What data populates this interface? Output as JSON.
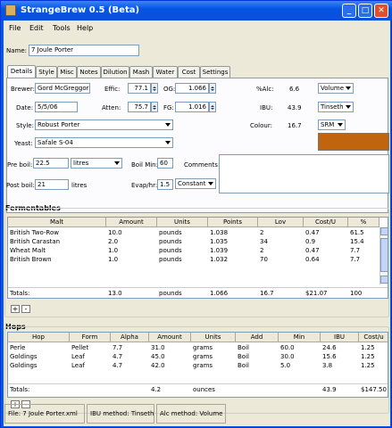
{
  "window": {
    "title": "StrangeBrew 0.5 (Beta)"
  },
  "menu": [
    "File",
    "Edit",
    "Tools",
    "Help"
  ],
  "name": {
    "label": "Name:",
    "value": "7 Joule Porter"
  },
  "tabs": [
    "Details",
    "Style",
    "Misc",
    "Notes",
    "Dilution",
    "Mash",
    "Water",
    "Cost",
    "Settings"
  ],
  "details": {
    "brewer_label": "Brewer:",
    "brewer": "Gord McGreggor",
    "effic_label": "Effic:",
    "effic": "77.1",
    "og_label": "OG:",
    "og": "1.066",
    "alc_label": "%Alc:",
    "alc": "6.6",
    "alc_method": "Volume",
    "date_label": "Date:",
    "date": "5/5/06",
    "atten_label": "Atten:",
    "atten": "75.7",
    "fg_label": "FG:",
    "fg": "1.016",
    "ibu_label": "IBU:",
    "ibu": "43.9",
    "ibu_method": "Tinseth",
    "style_label": "Style:",
    "style": "Robust Porter",
    "colour_label": "Colour:",
    "colour": "16.7",
    "colour_method": "SRM",
    "colour_swatch": "#c0650e",
    "yeast_label": "Yeast:",
    "yeast": "Safale S-04",
    "preboil_label": "Pre boil:",
    "preboil": "22.5",
    "preboil_unit": "litres",
    "boilmin_label": "Boil Min:",
    "boilmin": "60",
    "comments_label": "Comments:",
    "postboil_label": "Post boil:",
    "postboil": "21",
    "postboil_unit": "litres",
    "evap_label": "Evap/hr:",
    "evap": "1.5",
    "evap_method": "Constant"
  },
  "fermentables": {
    "title": "Fermentables",
    "headers": [
      "Malt",
      "Amount",
      "Units",
      "Points",
      "Lov",
      "Cost/U",
      "%"
    ],
    "rows": [
      [
        "British Two-Row",
        "10.0",
        "pounds",
        "1.038",
        "2",
        "0.47",
        "61.5"
      ],
      [
        "British Carastan",
        "2.0",
        "pounds",
        "1.035",
        "34",
        "0.9",
        "15.4"
      ],
      [
        "Wheat Malt",
        "1.0",
        "pounds",
        "1.039",
        "2",
        "0.47",
        "7.7"
      ],
      [
        "British Brown",
        "1.0",
        "pounds",
        "1.032",
        "70",
        "0.64",
        "7.7"
      ]
    ],
    "totals": [
      "Totals:",
      "13.0",
      "pounds",
      "1.066",
      "16.7",
      "$21.07",
      "100"
    ]
  },
  "hops": {
    "title": "Hops",
    "headers": [
      "Hop",
      "Form",
      "Alpha",
      "Amount",
      "Units",
      "Add",
      "Min",
      "IBU",
      "Cost/u"
    ],
    "rows": [
      [
        "Perle",
        "Pellet",
        "7.7",
        "31.0",
        "grams",
        "Boil",
        "60.0",
        "24.6",
        "1.25"
      ],
      [
        "Goldings",
        "Leaf",
        "4.7",
        "45.0",
        "grams",
        "Boil",
        "30.0",
        "15.6",
        "1.25"
      ],
      [
        "Goldings",
        "Leaf",
        "4.7",
        "42.0",
        "grams",
        "Boil",
        "5.0",
        "3.8",
        "1.25"
      ]
    ],
    "totals": [
      "Totals:",
      "4.2",
      "ounces",
      "43.9",
      "$147.50"
    ]
  },
  "buttons": {
    "plus": "+",
    "minus": "-"
  },
  "status": {
    "file": "File: 7 Joule Porter.xml",
    "ibu": "IBU method: Tinseth",
    "alc": "Alc method: Volume"
  }
}
